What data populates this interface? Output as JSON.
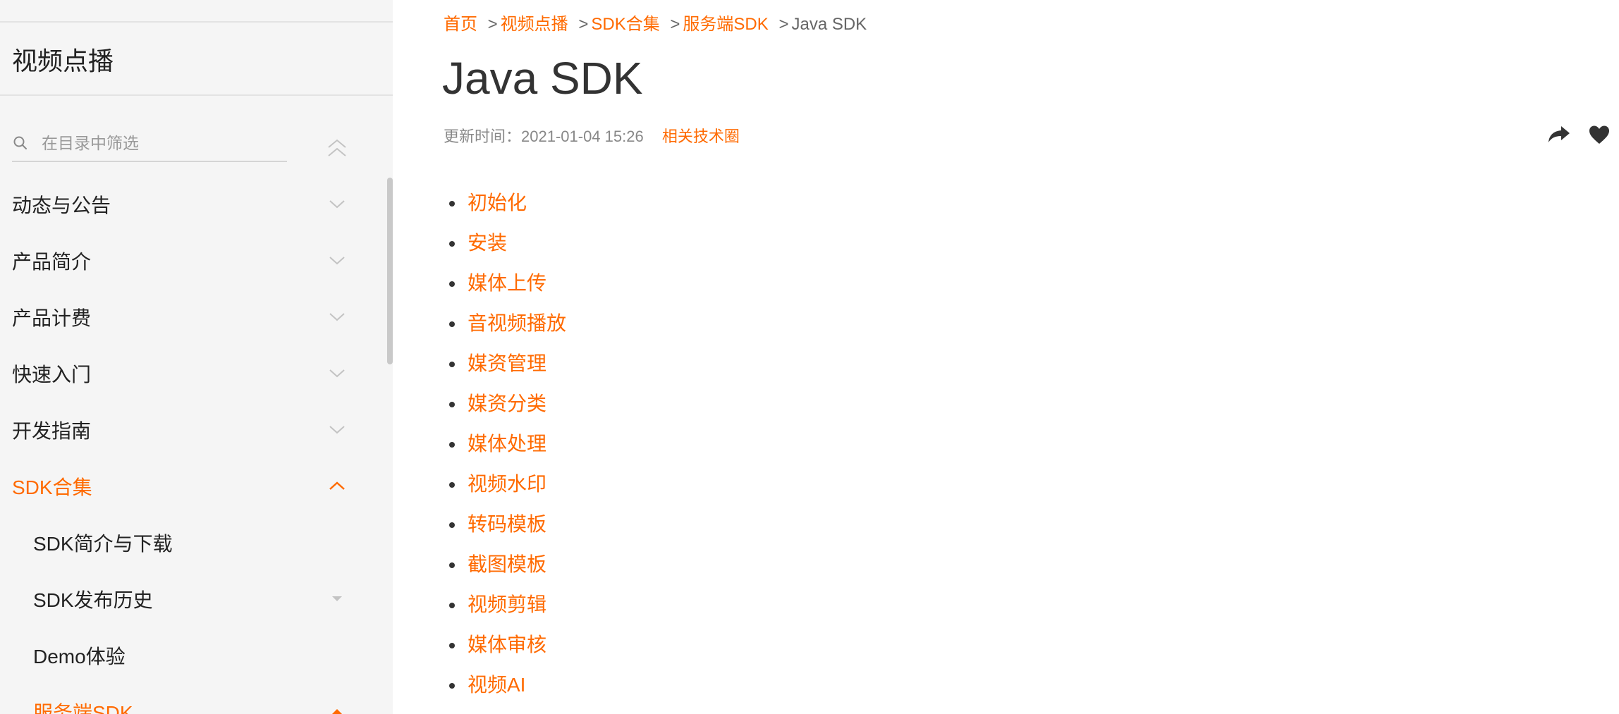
{
  "sidebar": {
    "title": "视频点播",
    "filter_placeholder": "在目录中筛选",
    "items": [
      {
        "label": "动态与公告",
        "chevron": "chevron-down"
      },
      {
        "label": "产品简介",
        "chevron": "chevron-down"
      },
      {
        "label": "产品计费",
        "chevron": "chevron-down"
      },
      {
        "label": "快速入门",
        "chevron": "chevron-down"
      },
      {
        "label": "开发指南",
        "chevron": "chevron-down"
      },
      {
        "label": "SDK合集",
        "chevron": "chevron-up",
        "active": true
      },
      {
        "label": "SDK简介与下载"
      },
      {
        "label": "SDK发布历史",
        "chevron": "caret-down"
      },
      {
        "label": "Demo体验"
      },
      {
        "label": "服务端SDK",
        "chevron": "chevron-up",
        "active": true
      }
    ]
  },
  "breadcrumb": {
    "items": [
      "首页",
      "视频点播",
      "SDK合集",
      "服务端SDK"
    ],
    "separator": ">",
    "current": "Java SDK"
  },
  "page": {
    "title": "Java SDK",
    "updated": "更新时间：2021-01-04 15:26",
    "related_link": "相关技术圈"
  },
  "toc": {
    "items": [
      "初始化",
      "安装",
      "媒体上传",
      "音视频播放",
      "媒资管理",
      "媒资分类",
      "媒体处理",
      "视频水印",
      "转码模板",
      "截图模板",
      "视频剪辑",
      "媒体审核",
      "视频AI"
    ]
  },
  "colors": {
    "accent": "#ff6a00",
    "sidebar_bg": "#f5f5f5",
    "text": "#333333",
    "muted": "#888888"
  }
}
